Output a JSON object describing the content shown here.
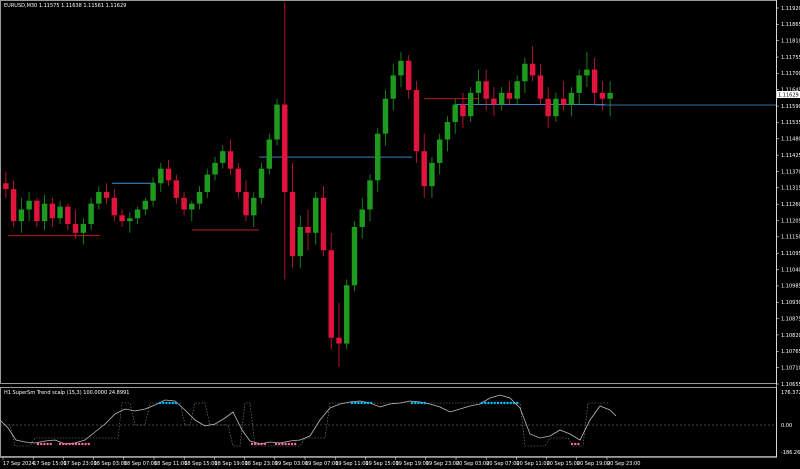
{
  "window": {
    "title": "EURUSD,M30  1.11575 1.11638 1.11561 1.11629"
  },
  "price_axis": {
    "ticks": [
      "1.11920",
      "1.11865",
      "1.11810",
      "1.11755",
      "1.11700",
      "1.11645",
      "1.11590",
      "1.11535",
      "1.11480",
      "1.11425",
      "1.11370",
      "1.11315",
      "1.11260",
      "1.11205",
      "1.11150",
      "1.11095",
      "1.11040",
      "1.10985",
      "1.10930",
      "1.10875",
      "1.10820",
      "1.10765",
      "1.10710",
      "1.10655"
    ],
    "current_price": "1.11629"
  },
  "indicator": {
    "title": "H1 SuperSm Trend scalp (15,3) 100.0000 24.8991",
    "ticks": [
      "176.3727",
      "0.00",
      "-186.2652"
    ]
  },
  "time_axis": {
    "labels": [
      "17 Sep 2024",
      "17 Sep 15:00",
      "17 Sep 23:00",
      "18 Sep 03:00",
      "18 Sep 07:00",
      "18 Sep 11:00",
      "18 Sep 15:00",
      "18 Sep 19:00",
      "18 Sep 23:00",
      "19 Sep 03:00",
      "19 Sep 07:00",
      "19 Sep 11:00",
      "19 Sep 15:00",
      "19 Sep 19:00",
      "19 Sep 23:00",
      "20 Sep 03:00",
      "20 Sep 07:00",
      "20 Sep 11:00",
      "20 Sep 15:00",
      "20 Sep 19:00",
      "20 Sep 23:00"
    ]
  },
  "colors": {
    "bull": "#1e9b1e",
    "bear": "#e0143c",
    "wick_bull": "#1e9b1e",
    "wick_bear": "#e0143c",
    "level_blue": "#3c96dc",
    "level_red": "#dc1e1e",
    "dots_blue": "#00bfff",
    "dots_pink": "#ff6e9b",
    "osc_line": "#cccccc",
    "grid": "#ffffff"
  },
  "chart_data": {
    "type": "candlestick",
    "symbol": "EURUSD",
    "timeframe": "M30",
    "ylim": [
      1.10655,
      1.11945
    ],
    "candles": [
      [
        1.1133,
        1.1137,
        1.1128,
        1.1131
      ],
      [
        1.1131,
        1.1134,
        1.1118,
        1.112
      ],
      [
        1.112,
        1.1128,
        1.1116,
        1.1124
      ],
      [
        1.1124,
        1.113,
        1.112,
        1.1127
      ],
      [
        1.1127,
        1.1128,
        1.1118,
        1.112
      ],
      [
        1.112,
        1.1129,
        1.1117,
        1.1126
      ],
      [
        1.1126,
        1.1128,
        1.1118,
        1.1121
      ],
      [
        1.1121,
        1.1127,
        1.1119,
        1.1125
      ],
      [
        1.1125,
        1.1126,
        1.1117,
        1.1119
      ],
      [
        1.1119,
        1.1124,
        1.1114,
        1.1116
      ],
      [
        1.1116,
        1.1121,
        1.1112,
        1.1119
      ],
      [
        1.1119,
        1.1128,
        1.1117,
        1.1126
      ],
      [
        1.1126,
        1.1132,
        1.1124,
        1.113
      ],
      [
        1.113,
        1.1133,
        1.1126,
        1.1128
      ],
      [
        1.1128,
        1.1131,
        1.112,
        1.1122
      ],
      [
        1.1122,
        1.1124,
        1.1118,
        1.112
      ],
      [
        1.112,
        1.1123,
        1.1116,
        1.1121
      ],
      [
        1.1121,
        1.1125,
        1.1119,
        1.1124
      ],
      [
        1.1124,
        1.1128,
        1.1122,
        1.1127
      ],
      [
        1.1127,
        1.1135,
        1.1125,
        1.1133
      ],
      [
        1.1133,
        1.114,
        1.113,
        1.1138
      ],
      [
        1.1138,
        1.1141,
        1.1132,
        1.1134
      ],
      [
        1.1134,
        1.1136,
        1.1126,
        1.1128
      ],
      [
        1.1128,
        1.113,
        1.1122,
        1.1124
      ],
      [
        1.1124,
        1.1127,
        1.112,
        1.1126
      ],
      [
        1.1126,
        1.1132,
        1.1124,
        1.113
      ],
      [
        1.113,
        1.1138,
        1.1128,
        1.1136
      ],
      [
        1.1136,
        1.1142,
        1.1134,
        1.114
      ],
      [
        1.114,
        1.1146,
        1.1138,
        1.1144
      ],
      [
        1.1144,
        1.1148,
        1.1136,
        1.1138
      ],
      [
        1.1138,
        1.114,
        1.1128,
        1.113
      ],
      [
        1.113,
        1.1134,
        1.112,
        1.1122
      ],
      [
        1.1122,
        1.113,
        1.1118,
        1.1128
      ],
      [
        1.1128,
        1.114,
        1.1126,
        1.1138
      ],
      [
        1.1138,
        1.115,
        1.1136,
        1.1148
      ],
      [
        1.1148,
        1.1162,
        1.1146,
        1.116
      ],
      [
        1.116,
        1.1195,
        1.11,
        1.113
      ],
      [
        1.113,
        1.114,
        1.1104,
        1.1108
      ],
      [
        1.1108,
        1.1122,
        1.1104,
        1.1118
      ],
      [
        1.1118,
        1.1124,
        1.111,
        1.1116
      ],
      [
        1.1116,
        1.113,
        1.1112,
        1.1128
      ],
      [
        1.1128,
        1.1132,
        1.1108,
        1.111
      ],
      [
        1.111,
        1.1116,
        1.1076,
        1.108
      ],
      [
        1.108,
        1.1092,
        1.107,
        1.1078
      ],
      [
        1.1078,
        1.11,
        1.1076,
        1.1098
      ],
      [
        1.1098,
        1.112,
        1.1096,
        1.1118
      ],
      [
        1.1118,
        1.1128,
        1.1114,
        1.1124
      ],
      [
        1.1124,
        1.1136,
        1.112,
        1.1134
      ],
      [
        1.1134,
        1.1152,
        1.113,
        1.115
      ],
      [
        1.115,
        1.1165,
        1.1146,
        1.1162
      ],
      [
        1.1162,
        1.1174,
        1.1158,
        1.117
      ],
      [
        1.117,
        1.1178,
        1.1166,
        1.1175
      ],
      [
        1.1175,
        1.1177,
        1.1162,
        1.1165
      ],
      [
        1.1165,
        1.1168,
        1.114,
        1.1144
      ],
      [
        1.1144,
        1.115,
        1.1128,
        1.1132
      ],
      [
        1.1132,
        1.1142,
        1.1128,
        1.114
      ],
      [
        1.114,
        1.115,
        1.1136,
        1.1148
      ],
      [
        1.1148,
        1.1156,
        1.1144,
        1.1154
      ],
      [
        1.1154,
        1.1162,
        1.115,
        1.116
      ],
      [
        1.116,
        1.1164,
        1.1152,
        1.1156
      ],
      [
        1.1156,
        1.1166,
        1.1154,
        1.1164
      ],
      [
        1.1164,
        1.1172,
        1.116,
        1.1168
      ],
      [
        1.1168,
        1.1172,
        1.1158,
        1.1162
      ],
      [
        1.1162,
        1.1166,
        1.1156,
        1.116
      ],
      [
        1.116,
        1.1166,
        1.1158,
        1.1164
      ],
      [
        1.1164,
        1.1168,
        1.116,
        1.1162
      ],
      [
        1.1162,
        1.117,
        1.116,
        1.1168
      ],
      [
        1.1168,
        1.1176,
        1.1164,
        1.1174
      ],
      [
        1.1174,
        1.118,
        1.1168,
        1.117
      ],
      [
        1.117,
        1.1174,
        1.116,
        1.1162
      ],
      [
        1.1162,
        1.1166,
        1.1152,
        1.1156
      ],
      [
        1.1156,
        1.1164,
        1.1154,
        1.1162
      ],
      [
        1.1162,
        1.1168,
        1.1158,
        1.116
      ],
      [
        1.116,
        1.1166,
        1.1156,
        1.1164
      ],
      [
        1.1164,
        1.1172,
        1.116,
        1.117
      ],
      [
        1.117,
        1.1178,
        1.1166,
        1.1172
      ],
      [
        1.1172,
        1.1176,
        1.116,
        1.1164
      ],
      [
        1.1164,
        1.1168,
        1.1158,
        1.1162
      ],
      [
        1.1162,
        1.1168,
        1.1156,
        1.1164
      ]
    ],
    "levels": [
      {
        "price": 1.1115,
        "color": "red",
        "from": 0.01,
        "to": 0.16
      },
      {
        "price": 1.1133,
        "color": "blue",
        "from": 0.18,
        "to": 0.25
      },
      {
        "price": 1.1117,
        "color": "red",
        "from": 0.31,
        "to": 0.42
      },
      {
        "price": 1.1142,
        "color": "blue",
        "from": 0.42,
        "to": 0.67
      },
      {
        "price": 1.116,
        "color": "blue",
        "from": 0.74,
        "to": 0.985
      },
      {
        "price": 1.1162,
        "color": "red",
        "from": 0.69,
        "to": 0.78
      }
    ]
  }
}
